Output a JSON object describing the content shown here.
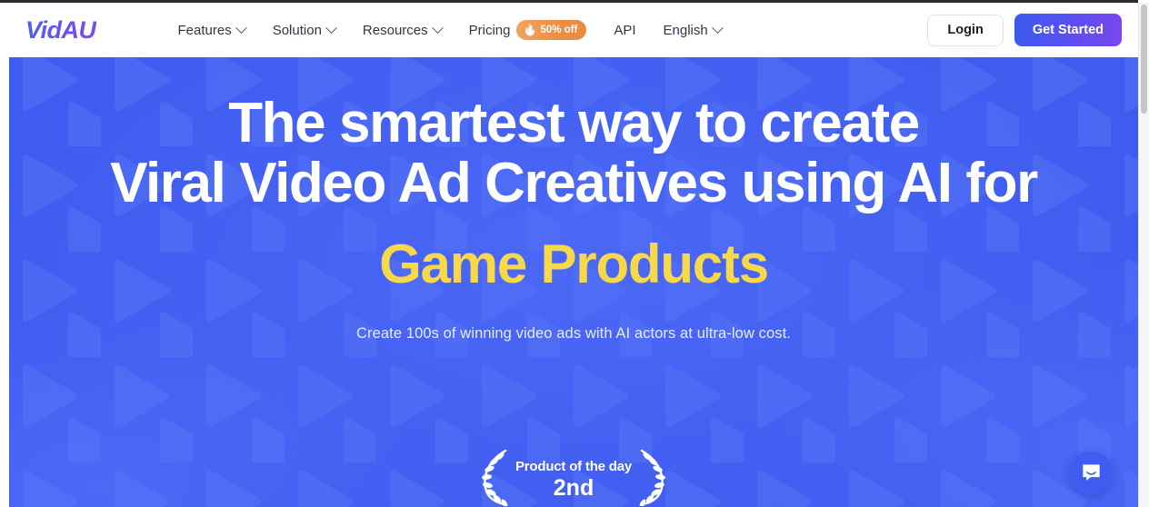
{
  "header": {
    "logo": "VidAU",
    "nav": [
      {
        "label": "Features",
        "icon": "chevron-down-icon",
        "has_caret": true,
        "name": "nav-item-features"
      },
      {
        "label": "Solution",
        "icon": "chevron-down-icon",
        "has_caret": true,
        "name": "nav-item-solution"
      },
      {
        "label": "Resources",
        "icon": "chevron-down-icon",
        "has_caret": true,
        "name": "nav-item-resources"
      }
    ],
    "pricing": {
      "label": "Pricing",
      "badge_text": "50% off",
      "badge_icon": "flame-icon",
      "badge_glyph": "🔥",
      "badge_color": "#ec9046"
    },
    "api_label": "API",
    "language": {
      "label": "English",
      "icon": "chevron-down-icon"
    },
    "login_label": "Login",
    "get_started_label": "Get Started"
  },
  "hero": {
    "headline_line1": "The smartest way to create",
    "headline_line2": "Viral Video Ad Creatives using AI for",
    "highlight": "Game Products",
    "highlight_color": "#F7D84B",
    "subtitle": "Create 100s of winning video ads with AI actors at ultra-low cost.",
    "background_color": "#3F5CF0",
    "award": {
      "title": "Product of the day",
      "rank": "2nd",
      "icon": "laurel-wreath-icon"
    }
  },
  "widgets": {
    "chat": {
      "icon": "chat-bubble-icon",
      "color": "#3F5CF0"
    }
  }
}
